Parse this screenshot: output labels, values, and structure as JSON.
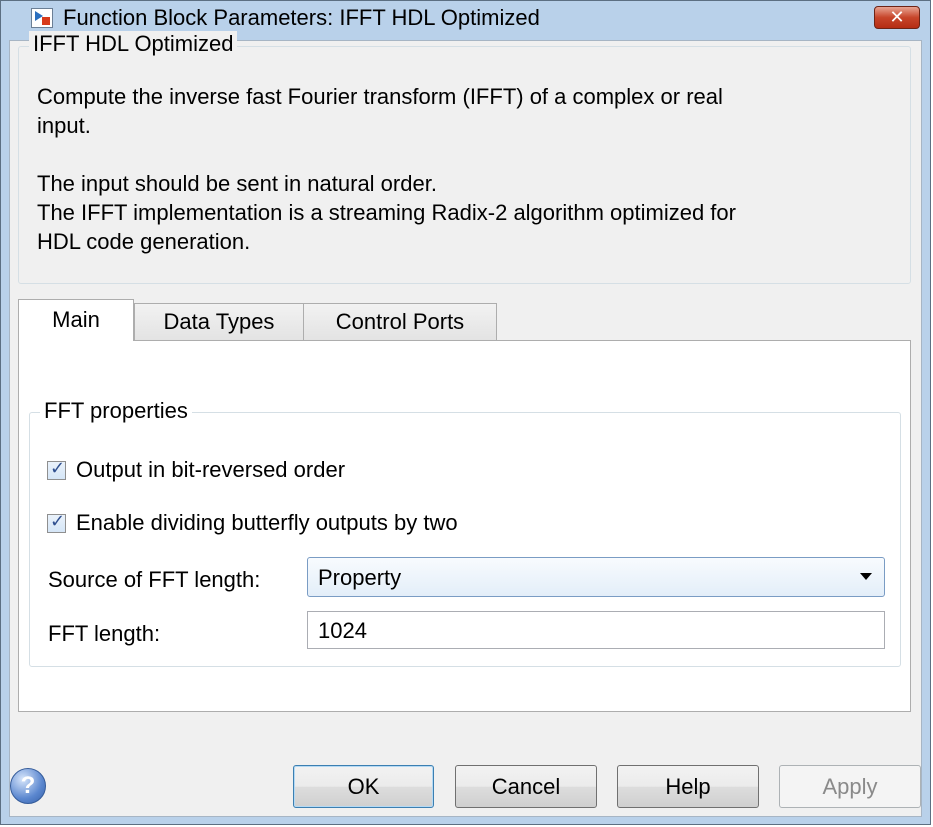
{
  "window": {
    "title": "Function Block Parameters: IFFT HDL Optimized",
    "close_glyph": "✕"
  },
  "description": {
    "group_title": "IFFT HDL Optimized",
    "para1_line1": "Compute the inverse fast Fourier transform (IFFT) of a complex or real",
    "para1_line2": "input.",
    "para2_line1": "The input should be sent in natural order.",
    "para2_line2": "The IFFT implementation is a streaming Radix-2 algorithm optimized for",
    "para2_line3": "HDL code generation."
  },
  "tabs": [
    {
      "label": "Main",
      "active": true
    },
    {
      "label": "Data Types",
      "active": false
    },
    {
      "label": "Control Ports",
      "active": false
    }
  ],
  "fft_properties": {
    "group_title": "FFT properties",
    "bit_reversed": {
      "label": "Output in bit-reversed order",
      "checked": true
    },
    "divide_by_two": {
      "label": "Enable dividing butterfly outputs by two",
      "checked": true
    },
    "source_label": "Source of FFT length:",
    "source_value": "Property",
    "length_label": "FFT length:",
    "length_value": "1024"
  },
  "buttons": {
    "ok": "OK",
    "cancel": "Cancel",
    "help": "Help",
    "apply": "Apply"
  },
  "icons": {
    "help": "question-mark-icon",
    "app": "simulink-block-icon",
    "dropdown": "chevron-down-icon"
  },
  "colors": {
    "title_bar": "#b9d1ea",
    "close_button": "#c7452a",
    "default_button_border": "#3c7fb1"
  }
}
